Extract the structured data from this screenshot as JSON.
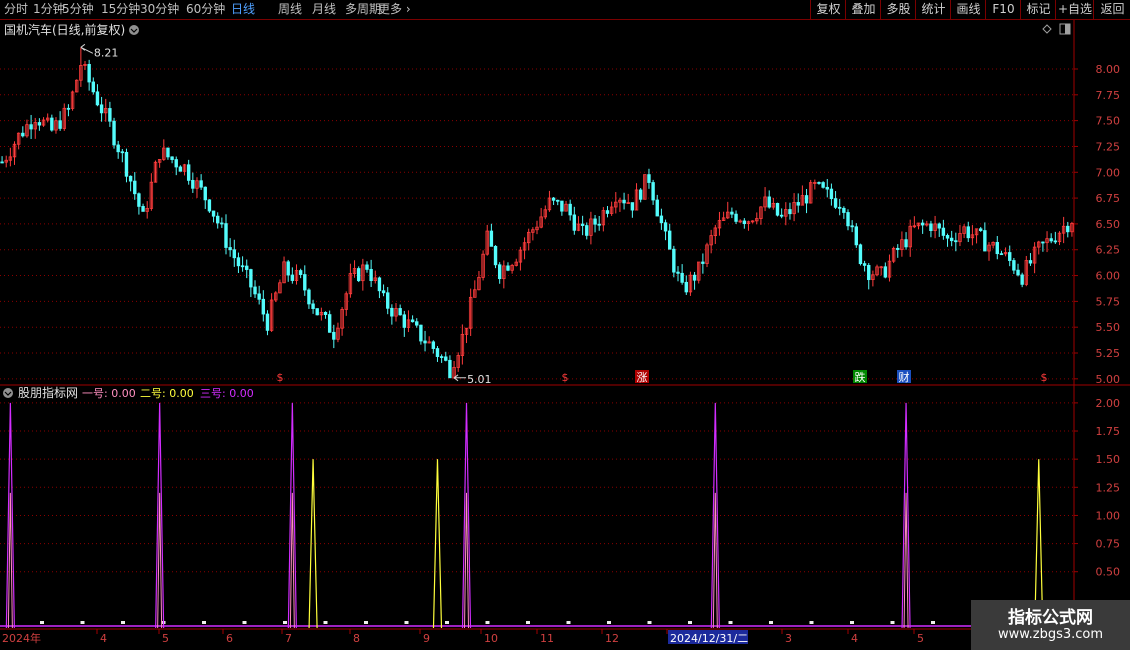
{
  "toolbar": {
    "periods": [
      "分时",
      "1分钟",
      "5分钟",
      "15分钟",
      "30分钟",
      "60分钟",
      "日线",
      "周线",
      "月线",
      "多周期",
      "更多"
    ],
    "active_period": "日线",
    "buttons": [
      "复权",
      "叠加",
      "多股",
      "统计",
      "画线",
      "F10",
      "标记",
      "+自选",
      "返回"
    ]
  },
  "colors": {
    "up": "#ff3c3c",
    "down": "#54fcfc",
    "axis_red": "#a00000",
    "line1": "#ff8fc0",
    "line2": "#ffff3c",
    "line3": "#d22dff"
  },
  "watermark": {
    "title": "指标公式网",
    "url": "www.zbgs3.com"
  },
  "chart_data": [
    {
      "type": "candlestick",
      "title": "国机汽车(日线,前复权)",
      "ylim": [
        4.95,
        8.3
      ],
      "yticks": [
        "8.00",
        "7.75",
        "7.50",
        "7.25",
        "7.00",
        "6.75",
        "6.50",
        "6.25",
        "6.00",
        "5.75",
        "5.50",
        "5.25",
        "5.00"
      ],
      "max_label": "8.21",
      "min_label": "5.01",
      "trend": [
        [
          0,
          7.1
        ],
        [
          4,
          7.35
        ],
        [
          8,
          7.55
        ],
        [
          12,
          7.4
        ],
        [
          16,
          7.6
        ],
        [
          19,
          8.05
        ],
        [
          23,
          7.7
        ],
        [
          26,
          7.45
        ],
        [
          30,
          7.05
        ],
        [
          34,
          6.55
        ],
        [
          38,
          7.2
        ],
        [
          44,
          7.05
        ],
        [
          50,
          6.7
        ],
        [
          55,
          6.25
        ],
        [
          60,
          5.9
        ],
        [
          64,
          5.55
        ],
        [
          68,
          6.05
        ],
        [
          72,
          5.95
        ],
        [
          76,
          5.65
        ],
        [
          80,
          5.45
        ],
        [
          84,
          5.95
        ],
        [
          88,
          6.1
        ],
        [
          92,
          5.75
        ],
        [
          96,
          5.6
        ],
        [
          100,
          5.45
        ],
        [
          104,
          5.3
        ],
        [
          108,
          5.1
        ],
        [
          111,
          5.4
        ],
        [
          114,
          5.85
        ],
        [
          117,
          6.35
        ],
        [
          120,
          6.05
        ],
        [
          124,
          6.2
        ],
        [
          128,
          6.45
        ],
        [
          132,
          6.7
        ],
        [
          136,
          6.65
        ],
        [
          140,
          6.4
        ],
        [
          144,
          6.55
        ],
        [
          148,
          6.8
        ],
        [
          152,
          6.7
        ],
        [
          156,
          6.95
        ],
        [
          160,
          6.35
        ],
        [
          164,
          5.85
        ],
        [
          168,
          6.05
        ],
        [
          172,
          6.45
        ],
        [
          176,
          6.6
        ],
        [
          180,
          6.55
        ],
        [
          184,
          6.7
        ],
        [
          188,
          6.55
        ],
        [
          192,
          6.7
        ],
        [
          196,
          6.85
        ],
        [
          200,
          6.75
        ],
        [
          203,
          6.7
        ],
        [
          206,
          6.25
        ],
        [
          209,
          6.05
        ],
        [
          212,
          6.0
        ],
        [
          216,
          6.25
        ],
        [
          220,
          6.45
        ],
        [
          224,
          6.5
        ],
        [
          228,
          6.35
        ],
        [
          232,
          6.45
        ],
        [
          236,
          6.35
        ],
        [
          240,
          6.25
        ],
        [
          244,
          6.1
        ],
        [
          246,
          6.0
        ],
        [
          250,
          6.25
        ],
        [
          254,
          6.4
        ],
        [
          258,
          6.55
        ]
      ],
      "markers": [
        "$",
        "$",
        "涨",
        "跌",
        "财",
        "$"
      ]
    },
    {
      "type": "line",
      "title": "股朋指标网",
      "legend": [
        {
          "label": "一号: 0.00",
          "color": "#ff8fc0"
        },
        {
          "label": "二号: 0.00",
          "color": "#ffff3c"
        },
        {
          "label": "三号: 0.00",
          "color": "#d22dff"
        }
      ],
      "ylim": [
        0,
        2.15
      ],
      "yticks": [
        "2.00",
        "1.75",
        "1.50",
        "1.25",
        "1.00",
        "0.75",
        "0.50"
      ],
      "x_labels": [
        "2024年",
        "4",
        "5",
        "6",
        "7",
        "8",
        "9",
        "10",
        "11",
        "12",
        "2024/12/31/二",
        "3",
        "4",
        "5"
      ],
      "magenta_spikes": [
        2,
        38,
        70,
        112,
        172,
        218
      ],
      "magenta_value": 2.0,
      "yellow_spikes": [
        75,
        105,
        250
      ],
      "yellow_value": 1.5
    }
  ]
}
